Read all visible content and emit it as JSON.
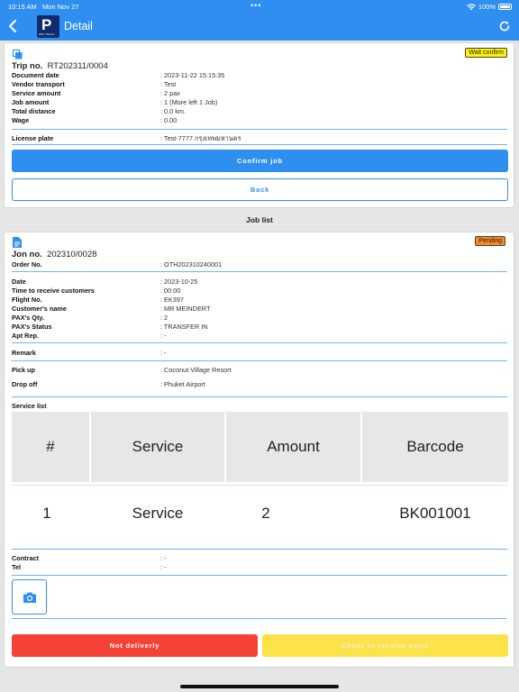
{
  "status_bar": {
    "time": "10:15 AM",
    "date": "Mon Nov 27",
    "battery": "100%"
  },
  "nav": {
    "title": "Detail",
    "logo_letter": "P",
    "logo_sub": "PRO TRACK"
  },
  "trip": {
    "status": "Wait confirm",
    "trip_no_label": "Trip no.",
    "trip_no": "RT202311/0004",
    "fields": [
      {
        "label": "Document date",
        "value": ": 2023-11-22 15:15:35"
      },
      {
        "label": "Vendor transport",
        "value": ": Test"
      },
      {
        "label": "Service amount",
        "value": ": 2 pax"
      },
      {
        "label": "Job amount",
        "value": ": 1 (More left 1 Job)"
      },
      {
        "label": "Total distance",
        "value": ": 0.0 km."
      },
      {
        "label": "Wage",
        "value": ": 0.00"
      }
    ],
    "license_label": "License plate",
    "license_value": ": Test-7777 กรุงเทพมหานคร",
    "confirm_label": "Confirm job",
    "back_label": "Back"
  },
  "job_list_title": "Job list",
  "job": {
    "status": "Pending",
    "job_no_label": "Jon no.",
    "job_no": "202310/0028",
    "order_label": "Order No.",
    "order_value": ": OTH202310240001",
    "fields": [
      {
        "label": "Date",
        "value": ": 2023-10-25"
      },
      {
        "label": "Time to receive customers",
        "value": ": 00:00"
      },
      {
        "label": "Flight No.",
        "value": ": EK397"
      },
      {
        "label": "Customer's name",
        "value": ": MR MEINDERT"
      },
      {
        "label": "PAX's Qty.",
        "value": ": 2"
      },
      {
        "label": "PAX's Status",
        "value": ": TRANSFER IN"
      },
      {
        "label": "Apt Rep.",
        "value": ": -"
      }
    ],
    "remark_label": "Remark",
    "remark_value": ": -",
    "pickup_label": "Pick up",
    "pickup_value": ": Coconut Village Resort",
    "dropoff_label": "Drop off",
    "dropoff_value": ": Phuket Airport",
    "service_list_label": "Service list",
    "table_headers": [
      "#",
      "Service",
      "Amount",
      "Barcode"
    ],
    "table_rows": [
      [
        "1",
        "Service",
        "2",
        "BK001001"
      ]
    ],
    "contract_label": "Contract",
    "contract_value": ": -",
    "tel_label": "Tel",
    "tel_value": ": -",
    "not_delivery_label": "Not deliverly",
    "checkin_label": "Check in receive point"
  },
  "colors": {
    "primary": "#2f8ff0",
    "danger": "#f44236",
    "warning": "#fde24a",
    "pending": "#f58a1f",
    "wait": "#fff200"
  }
}
